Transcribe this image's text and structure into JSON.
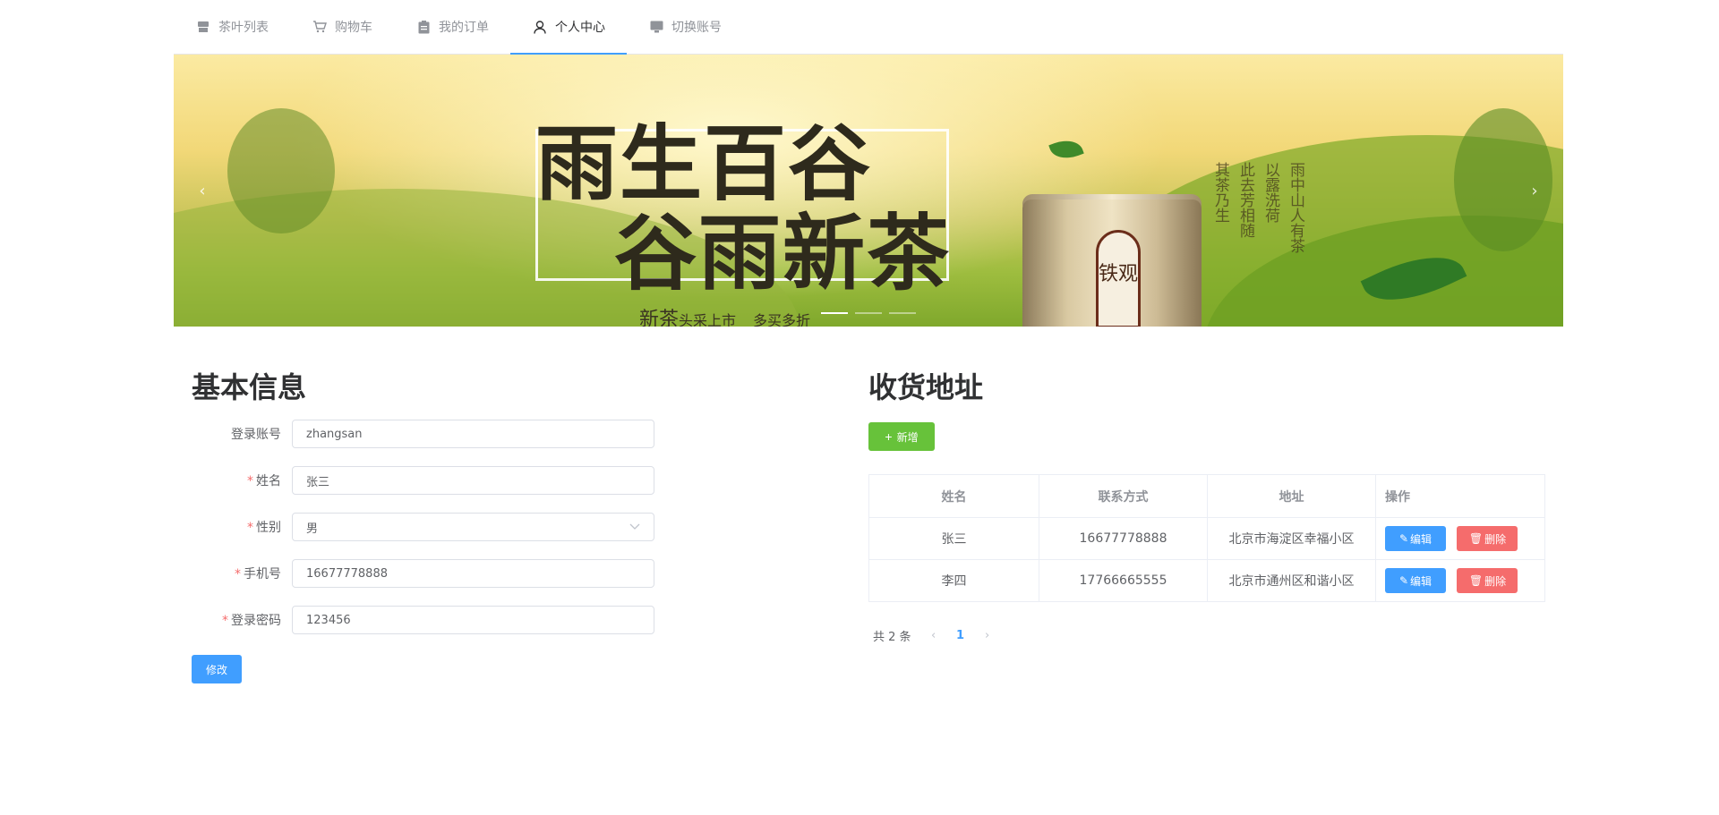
{
  "nav": {
    "items": [
      {
        "label": "茶叶列表",
        "icon": "shop-icon"
      },
      {
        "label": "购物车",
        "icon": "cart-icon"
      },
      {
        "label": "我的订单",
        "icon": "clipboard-icon"
      },
      {
        "label": "个人中心",
        "icon": "user-icon",
        "active": true
      },
      {
        "label": "切换账号",
        "icon": "monitor-icon"
      }
    ]
  },
  "banner": {
    "line1": "雨生百谷",
    "line2": "谷雨新茶",
    "line3_big": "新茶",
    "line3_small": "头采上市",
    "line3_tail": "多买多折",
    "can_text": "铁观",
    "prev_icon": "chevron-left-icon",
    "next_icon": "chevron-right-icon"
  },
  "profile": {
    "title": "基本信息",
    "fields": [
      {
        "label": "登录账号",
        "required": false,
        "value": "zhangsan"
      },
      {
        "label": "姓名",
        "required": true,
        "value": "张三"
      },
      {
        "label": "性别",
        "required": true,
        "value": "男",
        "select": true
      },
      {
        "label": "手机号",
        "required": true,
        "value": "16677778888"
      },
      {
        "label": "登录密码",
        "required": true,
        "value": "123456"
      }
    ],
    "submit_label": "修改"
  },
  "address": {
    "title": "收货地址",
    "add_label": "新增",
    "columns": [
      "姓名",
      "联系方式",
      "地址",
      "操作"
    ],
    "rows": [
      {
        "name": "张三",
        "phone": "16677778888",
        "addr": "北京市海淀区幸福小区"
      },
      {
        "name": "李四",
        "phone": "17766665555",
        "addr": "北京市通州区和谐小区"
      }
    ],
    "edit_label": "编辑",
    "delete_label": "删除",
    "pager": {
      "total_text": "共 2 条",
      "current": "1"
    }
  },
  "colors": {
    "primary": "#409eff",
    "success": "#67c23a",
    "danger": "#f56c6c"
  }
}
